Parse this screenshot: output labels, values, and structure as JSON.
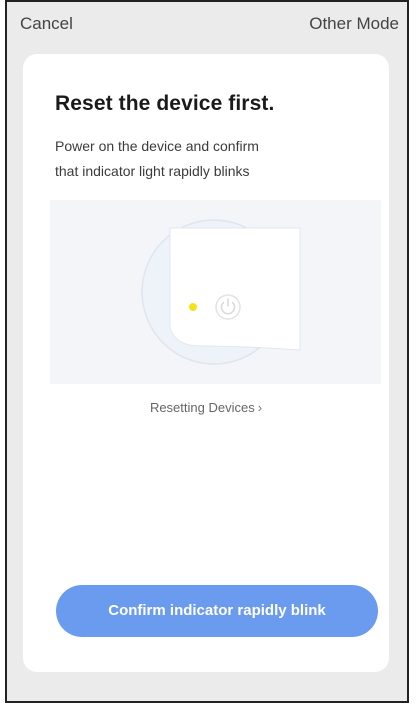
{
  "topbar": {
    "cancel_label": "Cancel",
    "other_mode_label": "Other Mode"
  },
  "card": {
    "title": "Reset the device first.",
    "description_line1": "Power on the device and confirm",
    "description_line2": "that indicator light rapidly blinks",
    "illustration": {
      "icons": [
        "device-illustration",
        "indicator-light-icon",
        "power-button-icon"
      ],
      "indicator_color": "#f2e21c",
      "background_color": "#f3f5f8"
    },
    "resetting_link_label": "Resetting Devices",
    "resetting_link_chevron": "›",
    "confirm_button_label": "Confirm indicator rapidly blink"
  },
  "colors": {
    "accent": "#6b9bef",
    "frame_background": "#ebebeb",
    "card_background": "#ffffff"
  }
}
